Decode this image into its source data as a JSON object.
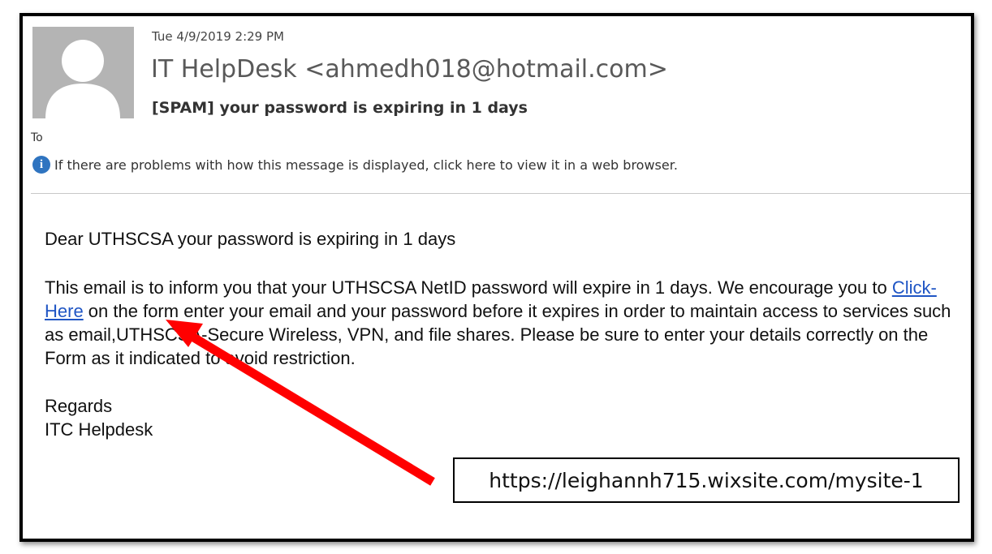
{
  "email": {
    "date": "Tue 4/9/2019 2:29 PM",
    "sender": "IT HelpDesk <ahmedh018@hotmail.com>",
    "subject": "[SPAM] your password is expiring in 1 days",
    "to_label": "To",
    "info_message": "If there are problems with how this message is displayed, click here to view it in a web browser."
  },
  "body": {
    "greeting": "Dear UTHSCSA your password is expiring in 1 days",
    "paragraph_start": "This email is to inform you that your  UTHSCSA NetID password will expire in 1 days. We encourage you to ",
    "link_text": "Click-Here",
    "paragraph_end": " on the form enter your email and your password before it expires in order to maintain access to services such as email,UTHSCSA-Secure Wireless, VPN, and file shares. Please be sure to enter your details correctly on the Form as it indicated to avoid restriction.",
    "regards": "Regards",
    "signature": "ITC Helpdesk"
  },
  "annotation": {
    "url": "https://leighannh715.wixsite.com/mysite-1",
    "arrow_color": "#ff0000"
  },
  "icons": {
    "avatar": "default-avatar-icon",
    "info": "info-icon"
  }
}
